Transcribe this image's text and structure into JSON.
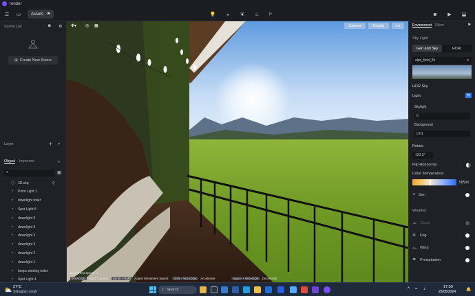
{
  "app": {
    "title": "render"
  },
  "toolbar": {
    "assets_label": "Assets"
  },
  "left": {
    "scene_list_label": "Scene List",
    "create_scene_label": "Create New Scene",
    "layer_label": "Layer",
    "tabs": [
      "Object",
      "Imported"
    ],
    "items": [
      {
        "label": "3D.skp",
        "icon": "cube-icon"
      },
      {
        "label": "Point Light 1",
        "icon": "bulb-icon"
      },
      {
        "label": "downlight toilet",
        "icon": "bulb-icon"
      },
      {
        "label": "Spot Light 5",
        "icon": "bulb-icon"
      },
      {
        "label": "downlight 3",
        "icon": "bulb-icon"
      },
      {
        "label": "downlight 3",
        "icon": "bulb-icon"
      },
      {
        "label": "downlight 3",
        "icon": "bulb-icon"
      },
      {
        "label": "downlight 3",
        "icon": "bulb-icon"
      },
      {
        "label": "downlight 2",
        "icon": "bulb-icon"
      },
      {
        "label": "downlight 1",
        "icon": "bulb-icon"
      },
      {
        "label": "lampu dinding toilet",
        "icon": "bulb-icon"
      },
      {
        "label": "Spot Light 4",
        "icon": "bulb-icon"
      }
    ]
  },
  "viewport": {
    "buttons": [
      "Camera",
      "Display"
    ],
    "movement_title": "Movement Speed: 4",
    "hints": [
      {
        "key": "WSADQE",
        "text": "Move Camera"
      },
      {
        "key": "Scroll + RMB",
        "text": "Adjust Movement Speed"
      },
      {
        "key": "Shift + WSADQE",
        "text": "Accelerate"
      },
      {
        "key": "Space + WSADQE",
        "text": "Decelerate"
      }
    ]
  },
  "right": {
    "tabs": [
      "Environment",
      "Effect"
    ],
    "sky_light_label": "Sky Light",
    "seg": [
      "Geo and Sky",
      "HDRI"
    ],
    "hdri_name": "alps_field_8k",
    "hdr_sky_label": "HDR Sky",
    "light_label": "Light",
    "skylight_label": "Skylight",
    "skylight_value": "0",
    "background_label": "Background",
    "background_value": "0.01",
    "rotate_label": "Rotate",
    "rotate_value": "123.3°",
    "flip_label": "Flip Horizontal",
    "color_temp_label": "Color Temperature",
    "color_temp_value": "5850K",
    "sun_label": "Sun",
    "weather_label": "Weather",
    "weather_items": [
      "Cloud",
      "Fog",
      "Wind",
      "Precipitation"
    ]
  },
  "taskbar": {
    "temp": "27°C",
    "weather_desc": "Sebagian cerah",
    "search_placeholder": "Search",
    "time": "17:50",
    "date": "25/05/2024"
  },
  "colors": {
    "accent": "#2f7bf5",
    "logo": "#7b4dff"
  }
}
